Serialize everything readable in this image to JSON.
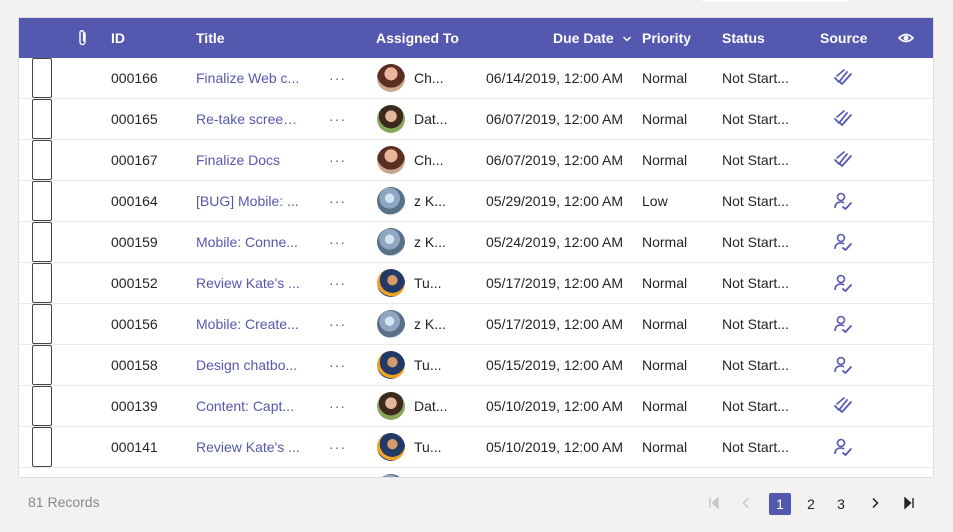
{
  "header": {
    "attachment_icon": "paperclip-icon",
    "id": "ID",
    "title": "Title",
    "assigned_to": "Assigned To",
    "due_date": "Due Date",
    "priority": "Priority",
    "status": "Status",
    "source": "Source",
    "view_icon": "eye-icon"
  },
  "more_label": "···",
  "rows": [
    {
      "id": "000166",
      "title": "Finalize Web c...",
      "assignee": "Ch...",
      "due": "06/14/2019, 12:00 AM",
      "priority": "Normal",
      "status": "Not Start...",
      "source": "double-check-icon"
    },
    {
      "id": "000165",
      "title": "Re-take screen...",
      "assignee": "Dat...",
      "due": "06/07/2019, 12:00 AM",
      "priority": "Normal",
      "status": "Not Start...",
      "source": "double-check-icon"
    },
    {
      "id": "000167",
      "title": "Finalize Docs",
      "assignee": "Ch...",
      "due": "06/07/2019, 12:00 AM",
      "priority": "Normal",
      "status": "Not Start...",
      "source": "double-check-icon"
    },
    {
      "id": "000164",
      "title": "[BUG] Mobile: ...",
      "assignee": "z K...",
      "due": "05/29/2019, 12:00 AM",
      "priority": "Low",
      "status": "Not Start...",
      "source": "person-assign-icon"
    },
    {
      "id": "000159",
      "title": "Mobile: Conne...",
      "assignee": "z K...",
      "due": "05/24/2019, 12:00 AM",
      "priority": "Normal",
      "status": "Not Start...",
      "source": "person-assign-icon"
    },
    {
      "id": "000152",
      "title": "Review Kate's ...",
      "assignee": "Tu...",
      "due": "05/17/2019, 12:00 AM",
      "priority": "Normal",
      "status": "Not Start...",
      "source": "person-assign-icon"
    },
    {
      "id": "000156",
      "title": "Mobile: Create...",
      "assignee": "z K...",
      "due": "05/17/2019, 12:00 AM",
      "priority": "Normal",
      "status": "Not Start...",
      "source": "person-assign-icon"
    },
    {
      "id": "000158",
      "title": "Design chatbo...",
      "assignee": "Tu...",
      "due": "05/15/2019, 12:00 AM",
      "priority": "Normal",
      "status": "Not Start...",
      "source": "person-assign-icon"
    },
    {
      "id": "000139",
      "title": "Content: Capt...",
      "assignee": "Dat...",
      "due": "05/10/2019, 12:00 AM",
      "priority": "Normal",
      "status": "Not Start...",
      "source": "double-check-icon"
    },
    {
      "id": "000141",
      "title": "Review Kate's ...",
      "assignee": "Tu...",
      "due": "05/10/2019, 12:00 AM",
      "priority": "Normal",
      "status": "Not Start...",
      "source": "person-assign-icon"
    }
  ],
  "footer": {
    "records": "81 Records",
    "pages": [
      "1",
      "2",
      "3"
    ],
    "current_page": "1"
  },
  "colors": {
    "accent": "#5558af",
    "background": "#f3f2f1"
  }
}
